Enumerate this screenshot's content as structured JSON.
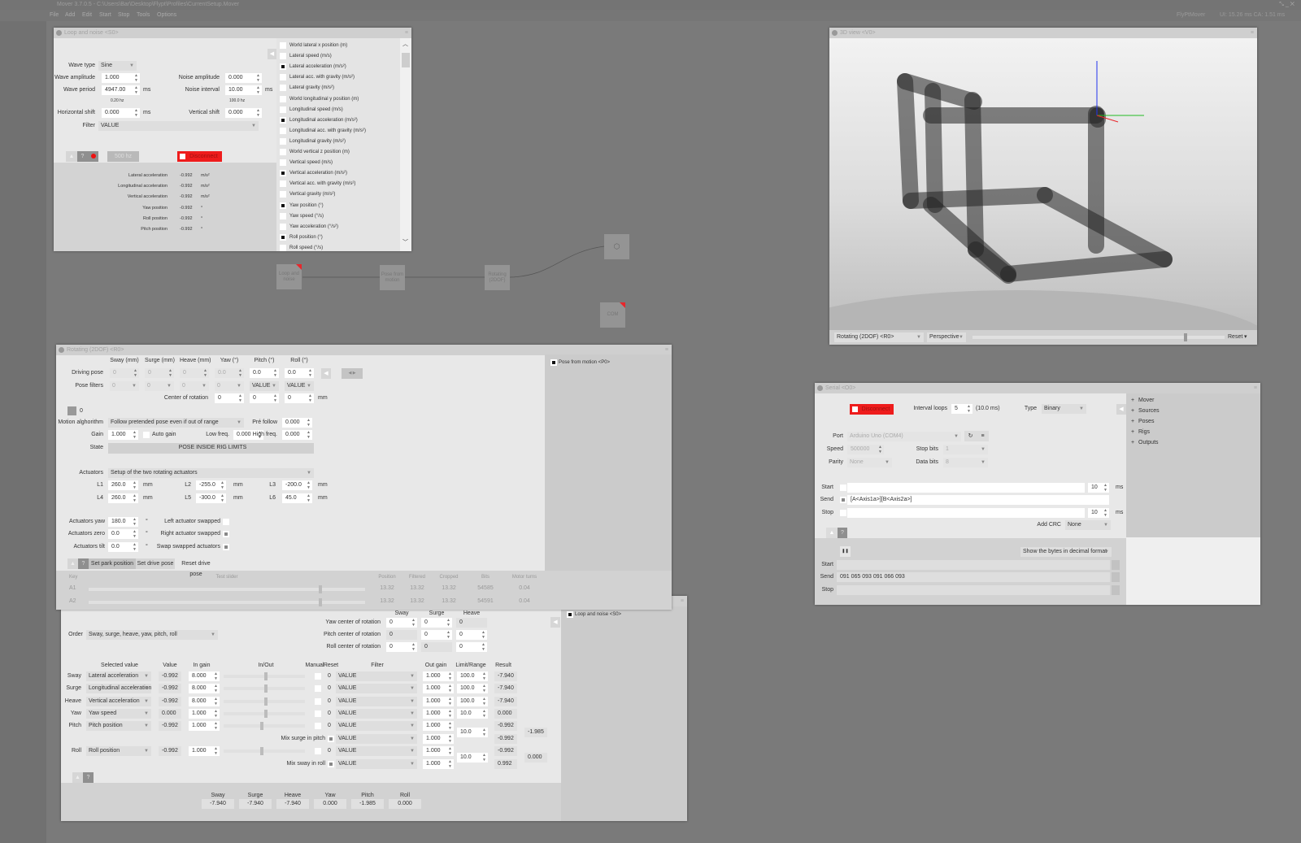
{
  "app": {
    "title": "Mover 3.7.0.5 - C:\\Users\\Bar\\Desktop\\Flypt\\Profiles\\CurrentSetup.Mover",
    "menu": [
      "File",
      "Add",
      "Edit",
      "Start",
      "Stop",
      "Tools",
      "Options"
    ],
    "logo": "FlyPtMover",
    "perf": "UI: 15.26 ms  CA: 1.51 ms"
  },
  "loop_noise": {
    "title": "Loop and noise <S0>",
    "wave_type_label": "Wave type",
    "wave_type": "Sine",
    "wave_amplitude_label": "Wave amplitude",
    "wave_amplitude": "1.000",
    "wave_period_label": "Wave period",
    "wave_period": "4947.00",
    "wave_period_unit": "ms",
    "wave_freq": "0.20 hz",
    "hshift_label": "Horizontal shift",
    "hshift": "0.000",
    "hshift_unit": "ms",
    "filter_label": "Filter",
    "filter": "VALUE",
    "noise_amplitude_label": "Noise amplitude",
    "noise_amplitude": "0.000",
    "noise_interval_label": "Noise interval",
    "noise_interval": "10.00",
    "noise_interval_unit": "ms",
    "noise_freq": "100.0 hz",
    "vshift_label": "Vertical shift",
    "vshift": "0.000",
    "rate": "500 hz",
    "disconnect": "Disconnect",
    "readouts": [
      {
        "label": "Lateral acceleration",
        "value": "-0.992",
        "unit": "m/s²"
      },
      {
        "label": "Longitudinal acceleration",
        "value": "-0.992",
        "unit": "m/s²"
      },
      {
        "label": "Vertical acceleration",
        "value": "-0.992",
        "unit": "m/s²"
      },
      {
        "label": "Yaw position",
        "value": "-0.992",
        "unit": "°"
      },
      {
        "label": "Roll position",
        "value": "-0.992",
        "unit": "°"
      },
      {
        "label": "Pitch position",
        "value": "-0.992",
        "unit": "°"
      }
    ],
    "outputs": [
      {
        "label": "World lateral x position (m)",
        "checked": false
      },
      {
        "label": "Lateral speed (m/s)",
        "checked": false
      },
      {
        "label": "Lateral acceleration (m/s²)",
        "checked": true
      },
      {
        "label": "Lateral acc. with gravity (m/s²)",
        "checked": false
      },
      {
        "label": "Lateral gravity (m/s²)",
        "checked": false
      },
      {
        "label": "World longitudinal y position (m)",
        "checked": false
      },
      {
        "label": "Longitudinal speed (m/s)",
        "checked": false
      },
      {
        "label": "Longitudinal acceleration (m/s²)",
        "checked": true
      },
      {
        "label": "Longitudinal acc. with gravity (m/s²)",
        "checked": false
      },
      {
        "label": "Longitudinal gravity (m/s²)",
        "checked": false
      },
      {
        "label": "World vertical z position (m)",
        "checked": false
      },
      {
        "label": "Vertical speed (m/s)",
        "checked": false
      },
      {
        "label": "Vertical acceleration (m/s²)",
        "checked": true
      },
      {
        "label": "Vertical acc. with gravity (m/s²)",
        "checked": false
      },
      {
        "label": "Vertical gravity (m/s²)",
        "checked": false
      },
      {
        "label": "Yaw position (°)",
        "checked": true
      },
      {
        "label": "Yaw speed (°/s)",
        "checked": false
      },
      {
        "label": "Yaw acceleration (°/s²)",
        "checked": false
      },
      {
        "label": "Roll position (°)",
        "checked": true
      },
      {
        "label": "Roll speed (°/s)",
        "checked": false
      }
    ]
  },
  "nodes": {
    "loop": "Loop and\nnoise",
    "pose": "Pose from\nmotion",
    "rig": "Rotating\n(2DOF)",
    "view3d": "3D",
    "com": "COM"
  },
  "view3d": {
    "title": "3D view <V0>",
    "rig": "Rotating (2DOF) <R0>",
    "projection": "Perspective",
    "reset": "Reset",
    "slider": 0.85,
    "colors": {
      "x": "#e8262b",
      "y": "#22bb22",
      "z": "#2233ee"
    }
  },
  "rotating": {
    "title": "Rotating (2DOF) <R0>",
    "axes": [
      "Sway (mm)",
      "Surge (mm)",
      "Heave (mm)",
      "Yaw (°)",
      "Pitch (°)",
      "Roll (°)"
    ],
    "driving_pose_label": "Driving pose",
    "driving_pose": [
      "0",
      "0",
      "0",
      "0.0",
      "0.0",
      "0.0"
    ],
    "pose_filters_label": "Pose filters",
    "pose_filters": [
      "0",
      "0",
      "0",
      "0",
      "VALUE",
      "VALUE"
    ],
    "center_label": "Center of rotation",
    "center": [
      "0",
      "0",
      "0"
    ],
    "center_unit": "mm",
    "ik_value": "0",
    "algorithm_label": "Motion alghorithm",
    "algorithm": "Follow pretended pose even if out of range",
    "pre_follow_label": "Pré follow",
    "pre_follow": "0.000",
    "gain_label": "Gain",
    "gain": "1.000",
    "auto_gain_label": "Auto gain",
    "low_freq_label": "Low freq.",
    "low_freq": "0.000",
    "high_freq_label": "High freq.",
    "high_freq": "0.000",
    "state_label": "State",
    "state": "POSE INSIDE RIG LIMITS",
    "actuators_label": "Actuators",
    "actuators": "Setup of the two rotating actuators",
    "lengths": [
      {
        "label": "L1",
        "value": "260.0"
      },
      {
        "label": "L2",
        "value": "-255.0"
      },
      {
        "label": "L3",
        "value": "-200.0"
      },
      {
        "label": "L4",
        "value": "260.0"
      },
      {
        "label": "L5",
        "value": "-300.0"
      },
      {
        "label": "L6",
        "value": "45.0"
      }
    ],
    "mm": "mm",
    "deg": "°",
    "act_yaw_label": "Actuators yaw",
    "act_yaw": "180.0",
    "act_zero_label": "Actuators zero",
    "act_zero": "0.0",
    "act_tilt_label": "Actuators tilt",
    "act_tilt": "0.0",
    "left_swapped_label": "Left actuator swapped",
    "left_swapped": false,
    "right_swapped_label": "Right actuator swapped",
    "right_swapped": true,
    "swap_swapped_label": "Swap swapped actuators",
    "swap_swapped": true,
    "help": "?",
    "set_park": "Set park position",
    "set_drive": "Set drive pose",
    "reset_drive": "Reset drive pose",
    "table_headers": [
      "Key",
      "Test slider",
      "Position",
      "Filtered",
      "Cropped",
      "Bits",
      "Motor turns"
    ],
    "table_rows": [
      {
        "key": "A1",
        "slider": 0.85,
        "position": "13.32",
        "filtered": "13.32",
        "cropped": "13.32",
        "bits": "54585",
        "turns": "0.04"
      },
      {
        "key": "A2",
        "slider": 0.85,
        "position": "13.32",
        "filtered": "13.32",
        "cropped": "13.32",
        "bits": "54591",
        "turns": "0.04"
      }
    ],
    "source_label": "Pose from motion <P0>",
    "source_checked": true
  },
  "pose": {
    "source_label": "Loop and noise <S0>",
    "source_checked": true,
    "cor_headers": [
      "Sway",
      "Surge",
      "Heave"
    ],
    "cor_rows": [
      {
        "label": "Yaw center of rotation",
        "values": [
          "0",
          "0",
          "0"
        ]
      },
      {
        "label": "Pitch center of rotation",
        "values": [
          "0",
          "0",
          "0"
        ]
      },
      {
        "label": "Roll center of rotation",
        "values": [
          "0",
          "0",
          "0"
        ]
      }
    ],
    "order_label": "Order",
    "order": "Sway, surge, heave, yaw, pitch, roll",
    "headers": {
      "selected": "Selected value",
      "value": "Value",
      "in_gain": "In gain",
      "inout": "In/Out",
      "manual": "Manual",
      "reset": "Reset",
      "filter": "Filter",
      "out_gain": "Out gain",
      "limit": "Limit/Range",
      "result": "Result"
    },
    "rows": [
      {
        "label": "Sway",
        "selected": "Lateral acceleration",
        "value": "-0.992",
        "in_gain": "8.000",
        "level": 0.5,
        "reset": "0",
        "filter": "VALUE",
        "out_gain": "1.000",
        "limit": "100.0",
        "result": "-7.940"
      },
      {
        "label": "Surge",
        "selected": "Longitudinal acceleration",
        "value": "-0.992",
        "in_gain": "8.000",
        "level": 0.5,
        "reset": "0",
        "filter": "VALUE",
        "out_gain": "1.000",
        "limit": "100.0",
        "result": "-7.940"
      },
      {
        "label": "Heave",
        "selected": "Vertical acceleration",
        "value": "-0.992",
        "in_gain": "8.000",
        "level": 0.5,
        "reset": "0",
        "filter": "VALUE",
        "out_gain": "1.000",
        "limit": "100.0",
        "result": "-7.940"
      },
      {
        "label": "Yaw",
        "selected": "Yaw speed",
        "value": "0.000",
        "in_gain": "1.000",
        "level": 0.5,
        "reset": "0",
        "filter": "VALUE",
        "out_gain": "1.000",
        "limit": "10.0",
        "result": "0.000"
      },
      {
        "label": "Pitch",
        "selected": "Pitch position",
        "value": "-0.992",
        "in_gain": "1.000",
        "level": 0.45,
        "reset": "0",
        "filter": "VALUE",
        "out_gain": "1.000",
        "result": "-0.992"
      },
      {
        "mix_label": "Mix surge in pitch",
        "mix_checked": true,
        "filter": "VALUE",
        "out_gain": "1.000",
        "result": "-0.992"
      },
      {
        "label": "Roll",
        "selected": "Roll position",
        "value": "-0.992",
        "in_gain": "1.000",
        "level": 0.45,
        "reset": "0",
        "filter": "VALUE",
        "out_gain": "1.000",
        "result": "-0.992"
      },
      {
        "mix_label": "Mix sway in roll",
        "mix_checked": true,
        "filter": "VALUE",
        "out_gain": "1.000",
        "result": "0.992"
      }
    ],
    "pitch_limit": "10.0",
    "pitch_total": "-1.985",
    "roll_limit": "10.0",
    "roll_total": "0.000",
    "help": "?",
    "totals": [
      {
        "label": "Sway",
        "value": "-7.940"
      },
      {
        "label": "Surge",
        "value": "-7.940"
      },
      {
        "label": "Heave",
        "value": "-7.940"
      },
      {
        "label": "Yaw",
        "value": "0.000"
      },
      {
        "label": "Pitch",
        "value": "-1.985"
      },
      {
        "label": "Roll",
        "value": "0.000"
      }
    ]
  },
  "serial": {
    "title": "Serial <O0>",
    "disconnect": "Disconnect",
    "interval_label": "Interval loops",
    "interval": "5",
    "interval_ms": "(10.0 ms)",
    "type_label": "Type",
    "type": "Binary",
    "port_label": "Port",
    "port": "Arduino Uno (COM4)",
    "speed_label": "Speed",
    "speed": "500000",
    "stop_bits_label": "Stop bits",
    "stop_bits": "1",
    "parity_label": "Parity",
    "parity": "None",
    "data_bits_label": "Data bits",
    "data_bits": "8",
    "start_label": "Start",
    "start": "",
    "start_ms": "10",
    "send_label": "Send",
    "send": "[A<Axis1a>][B<Axis2a>]",
    "stop_label": "Stop",
    "stop": "",
    "stop_ms": "10",
    "ms": "ms",
    "crc_label": "Add CRC",
    "crc": "None",
    "help": "?",
    "format": "Show the bytes in decimal format",
    "mon_start": "",
    "mon_send": "091 065 093 091 066 093",
    "mon_stop": "",
    "tree": [
      "Mover",
      "Sources",
      "Poses",
      "Rigs",
      "Outputs"
    ]
  }
}
